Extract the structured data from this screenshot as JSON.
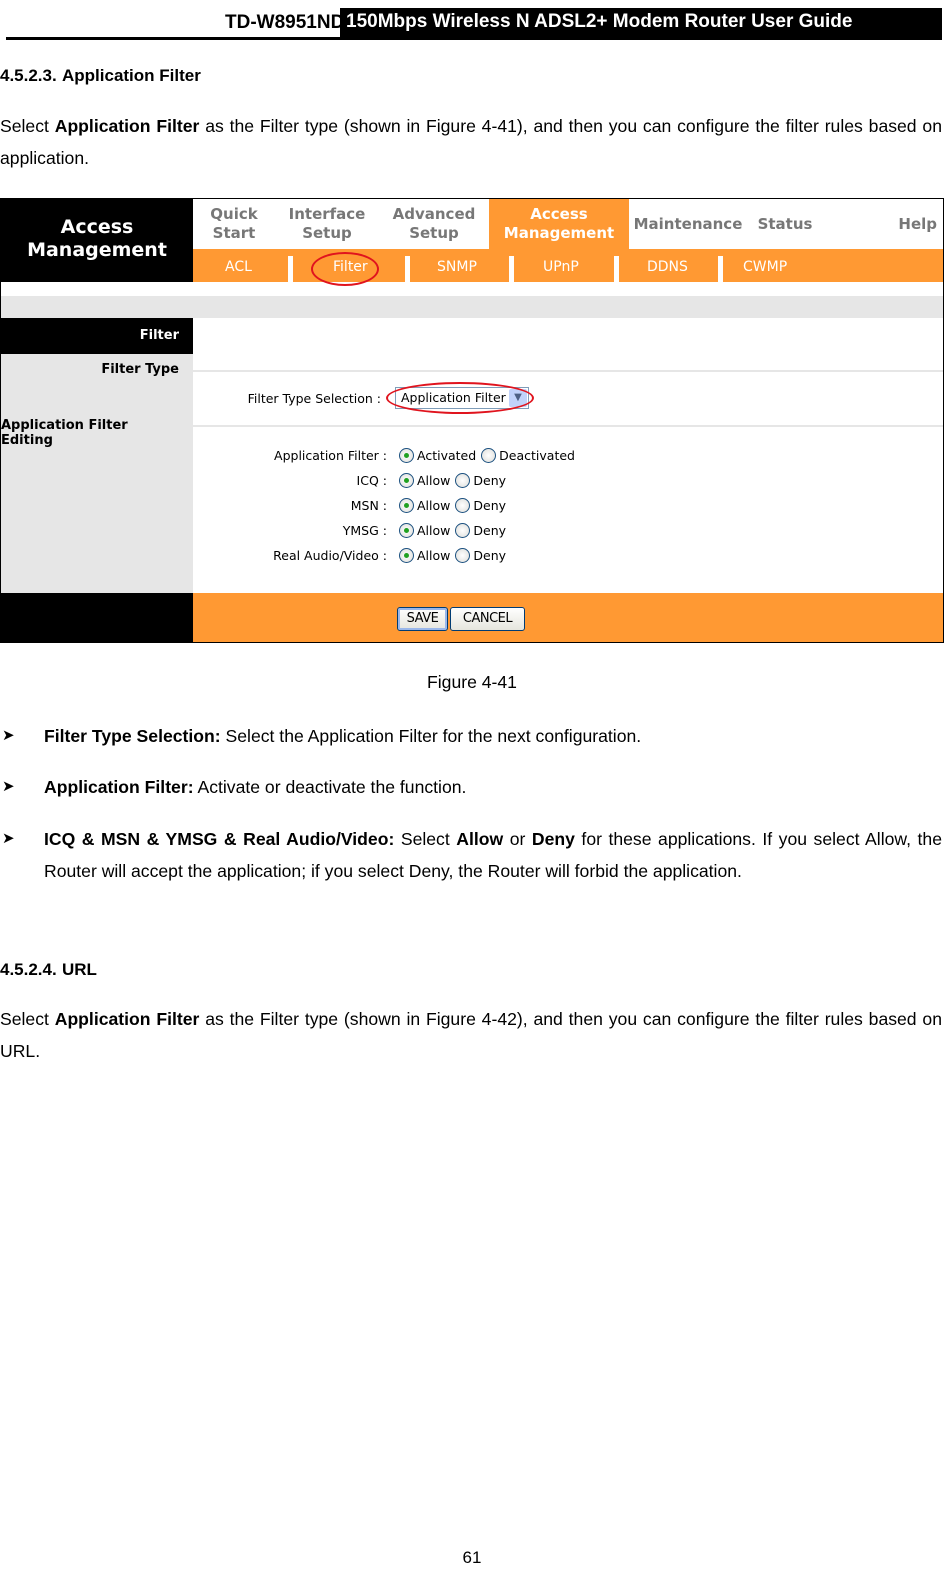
{
  "page_header": {
    "model": "TD-W8951ND",
    "title": "150Mbps Wireless N ADSL2+ Modem Router User Guide"
  },
  "section_app": {
    "number": "4.5.2.3.",
    "title": "Application Filter",
    "intro_pre": "Select ",
    "intro_bold": "Application Filter",
    "intro_post": " as the Filter type (shown in Figure 4-41), and then you can configure the filter rules based on application."
  },
  "router_ui": {
    "brand_line1": "Access",
    "brand_line2": "Management",
    "top_tabs": [
      {
        "line1": "Quick",
        "line2": "Start",
        "active": false
      },
      {
        "line1": "Interface",
        "line2": "Setup",
        "active": false
      },
      {
        "line1": "Advanced",
        "line2": "Setup",
        "active": false
      },
      {
        "line1": "Access",
        "line2": "Management",
        "active": true
      },
      {
        "line1": "Maintenance",
        "line2": "",
        "active": false
      },
      {
        "line1": "Status",
        "line2": "",
        "active": false
      },
      {
        "line1": "Help",
        "line2": "",
        "active": false
      }
    ],
    "sub_tabs": [
      "ACL",
      "Filter",
      "SNMP",
      "UPnP",
      "DDNS",
      "CWMP"
    ],
    "active_sub_tab": "Filter",
    "sidebar": {
      "section": "Filter",
      "filter_type": "Filter Type",
      "editing": "Application Filter Editing"
    },
    "filter_type_label": "Filter Type Selection :",
    "filter_type_value": "Application Filter",
    "rows": [
      {
        "label": "Application Filter :",
        "opt1": "Activated",
        "opt2": "Deactivated",
        "selected": "Activated"
      },
      {
        "label": "ICQ :",
        "opt1": "Allow",
        "opt2": "Deny",
        "selected": "Allow"
      },
      {
        "label": "MSN :",
        "opt1": "Allow",
        "opt2": "Deny",
        "selected": "Allow"
      },
      {
        "label": "YMSG :",
        "opt1": "Allow",
        "opt2": "Deny",
        "selected": "Allow"
      },
      {
        "label": "Real Audio/Video :",
        "opt1": "Allow",
        "opt2": "Deny",
        "selected": "Allow"
      }
    ],
    "save_label": "SAVE",
    "cancel_label": "CANCEL",
    "colors": {
      "accent": "#ff9933",
      "highlight_ellipse": "#e0141e"
    }
  },
  "figure_caption": "Figure 4-41",
  "bullets": [
    {
      "bold": "Filter Type Selection:",
      "text": " Select the Application Filter for the next configuration."
    },
    {
      "bold": "Application Filter:",
      "text": " Activate or deactivate the function."
    },
    {
      "bold": "ICQ & MSN & YMSG & Real Audio/Video:",
      "t1": " Select ",
      "b2": "Allow",
      "t2": " or ",
      "b3": "Deny",
      "t3": " for these applications. If you select Allow, the Router will accept the application; if you select Deny, the Router will forbid the application."
    }
  ],
  "section_url": {
    "number": "4.5.2.4.",
    "title": "URL",
    "intro_pre": "Select ",
    "intro_bold": "Application Filter",
    "intro_post": " as the Filter type (shown in Figure 4-42), and then you can configure the filter rules based on URL."
  },
  "page_number": "61"
}
